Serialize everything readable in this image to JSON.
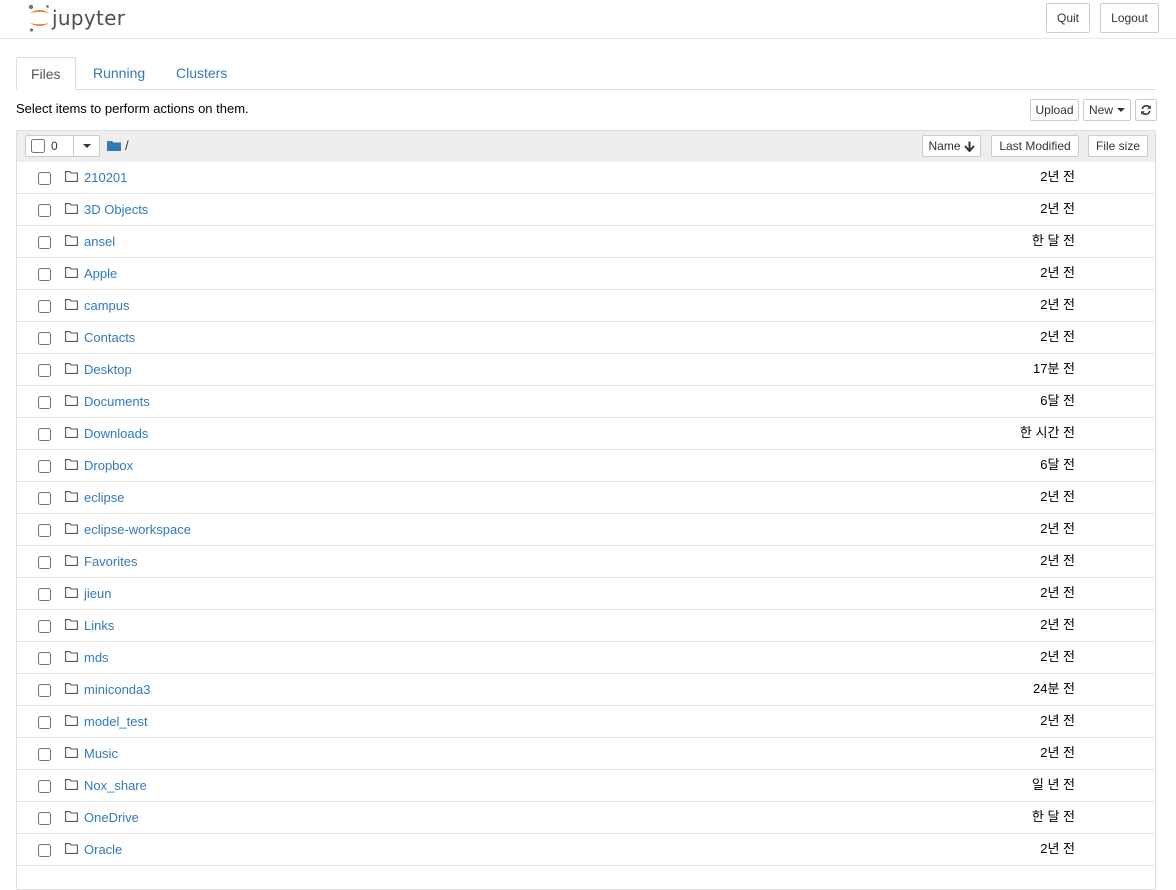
{
  "header": {
    "logo_text": "jupyter",
    "quit_label": "Quit",
    "logout_label": "Logout"
  },
  "tabs": [
    {
      "label": "Files",
      "active": true
    },
    {
      "label": "Running",
      "active": false
    },
    {
      "label": "Clusters",
      "active": false
    }
  ],
  "toolbar": {
    "hint": "Select items to perform actions on them.",
    "upload_label": "Upload",
    "new_label": "New"
  },
  "list_header": {
    "selected_count": "0",
    "path": "/",
    "sort_name_label": "Name",
    "sort_modified_label": "Last Modified",
    "sort_size_label": "File size"
  },
  "items": [
    {
      "name": "210201",
      "modified": "2년 전"
    },
    {
      "name": "3D Objects",
      "modified": "2년 전"
    },
    {
      "name": "ansel",
      "modified": "한 달 전"
    },
    {
      "name": "Apple",
      "modified": "2년 전"
    },
    {
      "name": "campus",
      "modified": "2년 전"
    },
    {
      "name": "Contacts",
      "modified": "2년 전"
    },
    {
      "name": "Desktop",
      "modified": "17분 전"
    },
    {
      "name": "Documents",
      "modified": "6달 전"
    },
    {
      "name": "Downloads",
      "modified": "한 시간 전"
    },
    {
      "name": "Dropbox",
      "modified": "6달 전"
    },
    {
      "name": "eclipse",
      "modified": "2년 전"
    },
    {
      "name": "eclipse-workspace",
      "modified": "2년 전"
    },
    {
      "name": "Favorites",
      "modified": "2년 전"
    },
    {
      "name": "jieun",
      "modified": "2년 전"
    },
    {
      "name": "Links",
      "modified": "2년 전"
    },
    {
      "name": "mds",
      "modified": "2년 전"
    },
    {
      "name": "miniconda3",
      "modified": "24분 전"
    },
    {
      "name": "model_test",
      "modified": "2년 전"
    },
    {
      "name": "Music",
      "modified": "2년 전"
    },
    {
      "name": "Nox_share",
      "modified": "일 년 전"
    },
    {
      "name": "OneDrive",
      "modified": "한 달 전"
    },
    {
      "name": "Oracle",
      "modified": "2년 전"
    }
  ],
  "colors": {
    "link": "#337ab7",
    "logo_orange": "#f37726",
    "header_bg": "#eeeeee"
  }
}
